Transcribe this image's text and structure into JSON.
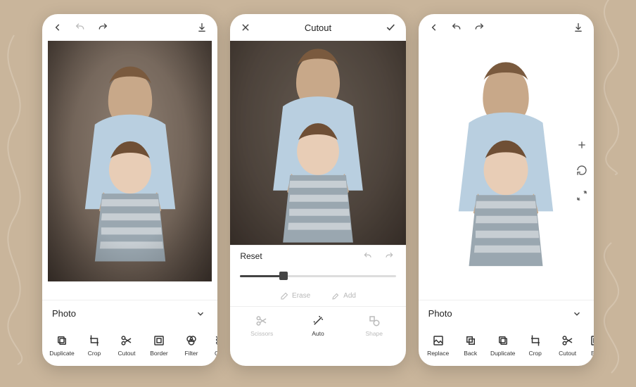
{
  "screens": {
    "left": {
      "section_label": "Photo",
      "tools": [
        "Duplicate",
        "Crop",
        "Cutout",
        "Border",
        "Filter",
        "Opacity"
      ]
    },
    "middle": {
      "title": "Cutout",
      "reset_label": "Reset",
      "slider_percent": 28,
      "sub_tools": {
        "erase": "Erase",
        "add": "Add"
      },
      "bottom_tools": [
        "Scissors",
        "Auto",
        "Shape"
      ],
      "active_bottom_tool": "Auto"
    },
    "right": {
      "section_label": "Photo",
      "tools": [
        "Replace",
        "Back",
        "Duplicate",
        "Crop",
        "Cutout",
        "Border"
      ]
    }
  },
  "icons": {
    "back": "chevron-left-icon",
    "undo": "undo-icon",
    "redo": "redo-icon",
    "download": "download-icon",
    "close": "close-icon",
    "check": "check-icon",
    "chevron_down": "chevron-down-icon",
    "plus": "plus-icon",
    "refresh": "refresh-icon",
    "expand": "expand-icon"
  },
  "colors": {
    "page_bg": "#c9b59b",
    "card_bg": "#ffffff",
    "text": "#222222",
    "muted": "#bbbbbb"
  }
}
